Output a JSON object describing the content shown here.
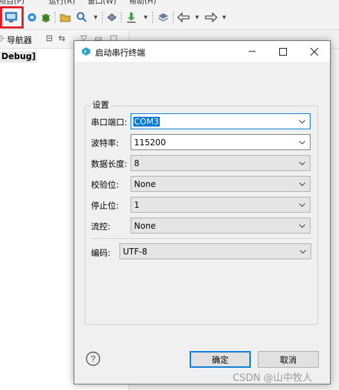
{
  "ide": {
    "menu_items": [
      "项目(P)",
      "运行(R)",
      "窗口(W)",
      "帮助(H)"
    ],
    "navigator_title": "导航器",
    "tree_item": "Debug]"
  },
  "dialog": {
    "title": "启动串行终端",
    "group_title": "设置",
    "fields": {
      "port": {
        "label": "串口端口:",
        "value": "COM3"
      },
      "baud": {
        "label": "波特率:",
        "value": "115200"
      },
      "databits": {
        "label": "数据长度:",
        "value": "8"
      },
      "parity": {
        "label": "校验位:",
        "value": "None"
      },
      "stopbits": {
        "label": "停止位:",
        "value": "1"
      },
      "flow": {
        "label": "流控:",
        "value": "None"
      },
      "encoding": {
        "label": "编码:",
        "value": "UTF-8"
      }
    },
    "ok_label": "确定",
    "cancel_label": "取消",
    "help_symbol": "?"
  },
  "watermark": "CSDN @山中牧人",
  "colors": {
    "accent": "#0078d7",
    "highlight": "#e51c23"
  }
}
